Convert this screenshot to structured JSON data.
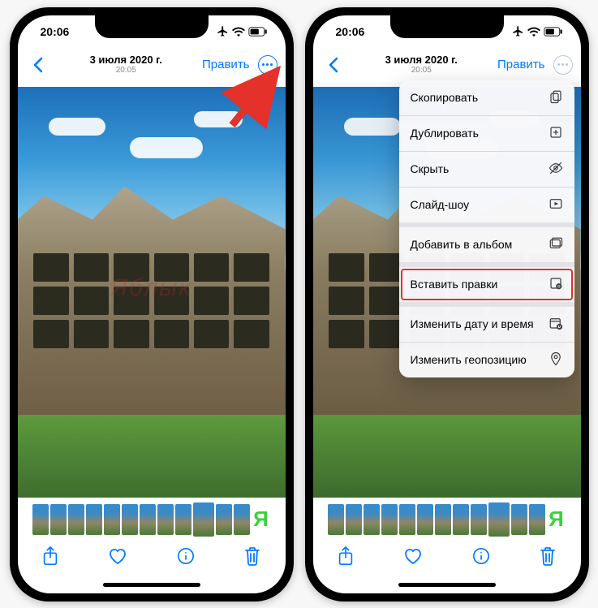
{
  "status": {
    "time": "20:06"
  },
  "nav": {
    "date": "3 июля 2020 г.",
    "time": "20:05",
    "edit": "Править"
  },
  "watermark": "Яблык",
  "thumbs_count": 13,
  "menu": {
    "items": [
      {
        "label": "Скопировать",
        "icon": "copy-icon"
      },
      {
        "label": "Дублировать",
        "icon": "duplicate-icon"
      },
      {
        "label": "Скрыть",
        "icon": "hide-icon"
      },
      {
        "label": "Слайд-шоу",
        "icon": "slideshow-icon"
      },
      {
        "label": "Добавить в альбом",
        "icon": "add-album-icon",
        "gap_before": true
      },
      {
        "label": "Вставить правки",
        "icon": "paste-edits-icon",
        "gap_before": true,
        "highlight": true
      },
      {
        "label": "Изменить дату и время",
        "icon": "adjust-date-icon",
        "gap_before": true
      },
      {
        "label": "Изменить геопозицию",
        "icon": "adjust-location-icon"
      }
    ]
  }
}
